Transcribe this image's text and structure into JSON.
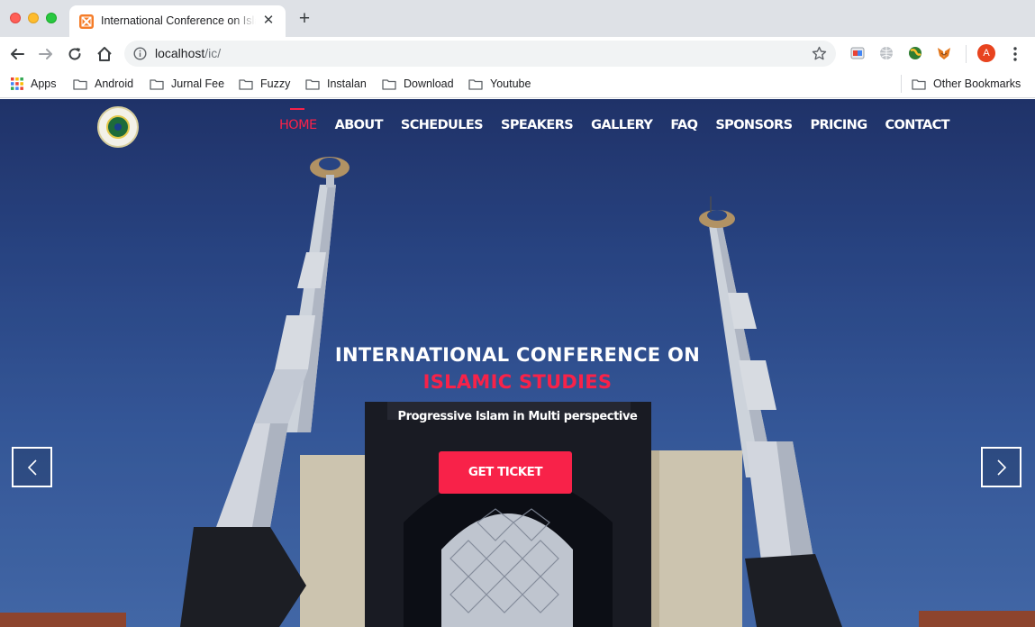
{
  "browser": {
    "tab_title": "International Conference on Islamic Studies",
    "url_host": "localhost",
    "url_path": "/ic/",
    "avatar_letter": "A",
    "accent": "#f57c28"
  },
  "bookmarks": {
    "apps_label": "Apps",
    "items": [
      "Android",
      "Jurnal Fee",
      "Fuzzy",
      "Instalan",
      "Download",
      "Youtube"
    ],
    "other_label": "Other Bookmarks"
  },
  "site": {
    "nav": [
      "HOME",
      "ABOUT",
      "SCHEDULES",
      "SPEAKERS",
      "GALLERY",
      "FAQ",
      "SPONSORS",
      "PRICING",
      "CONTACT"
    ],
    "active_nav": "HOME",
    "hero_title_line1": "INTERNATIONAL CONFERENCE ON",
    "hero_title_line2": "ISLAMIC STUDIES",
    "hero_subtitle": "Progressive Islam in Multi perspective",
    "cta_label": "GET TICKET",
    "accent": "#f82249"
  }
}
